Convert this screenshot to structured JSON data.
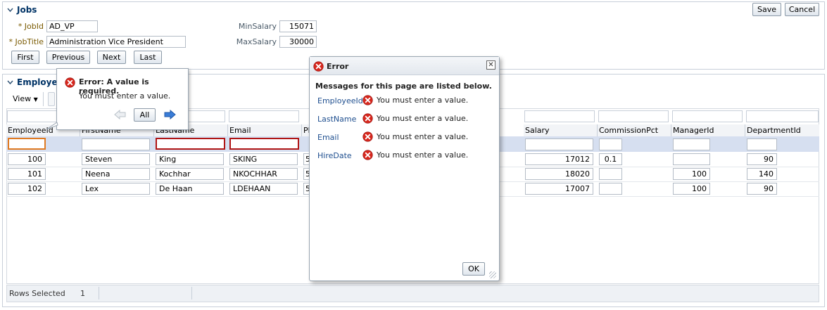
{
  "jobs": {
    "title": "Jobs",
    "save_label": "Save",
    "cancel_label": "Cancel",
    "jobid_label": "* JobId",
    "jobid_value": "AD_VP",
    "jobtitle_label": "* JobTitle",
    "jobtitle_value": "Administration Vice President",
    "minsalary_label": "MinSalary",
    "minsalary_value": "15071",
    "maxsalary_label": "MaxSalary",
    "maxsalary_value": "30000",
    "nav": [
      "First",
      "Previous",
      "Next",
      "Last"
    ]
  },
  "employees": {
    "title": "Employee",
    "view_label": "View",
    "columns": [
      "EmployeeId",
      "FirstName",
      "LastName",
      "Email",
      "Ph",
      "Salary",
      "CommissionPct",
      "ManagerId",
      "DepartmentId"
    ],
    "rows": [
      {
        "id": "100",
        "first": "Steven",
        "last": "King",
        "email": "SKING",
        "ph": "5",
        "salary": "17012",
        "comm": "0.1",
        "mgr": "",
        "dept": "90"
      },
      {
        "id": "101",
        "first": "Neena",
        "last": "Kochhar",
        "email": "NKOCHHAR",
        "ph": "5",
        "salary": "18020",
        "comm": "",
        "mgr": "100",
        "dept": "140"
      },
      {
        "id": "102",
        "first": "Lex",
        "last": "De Haan",
        "email": "LDEHAAN",
        "ph": "5",
        "salary": "17007",
        "comm": "",
        "mgr": "100",
        "dept": "90"
      }
    ],
    "status_label": "Rows Selected",
    "status_value": "1"
  },
  "tooltip": {
    "title": "Error: A value is required.",
    "message": "You must enter a value.",
    "all_label": "All"
  },
  "dialog": {
    "title": "Error",
    "header": "Messages for this page are listed below.",
    "messages": [
      {
        "field": "EmployeeId",
        "text": "You must enter a value."
      },
      {
        "field": "LastName",
        "text": "You must enter a value."
      },
      {
        "field": "Email",
        "text": "You must enter a value."
      },
      {
        "field": "HireDate",
        "text": "You must enter a value."
      }
    ],
    "ok_label": "OK"
  },
  "colors": {
    "error": "#c8241c",
    "link": "#1f4f8f",
    "title": "#003366"
  }
}
